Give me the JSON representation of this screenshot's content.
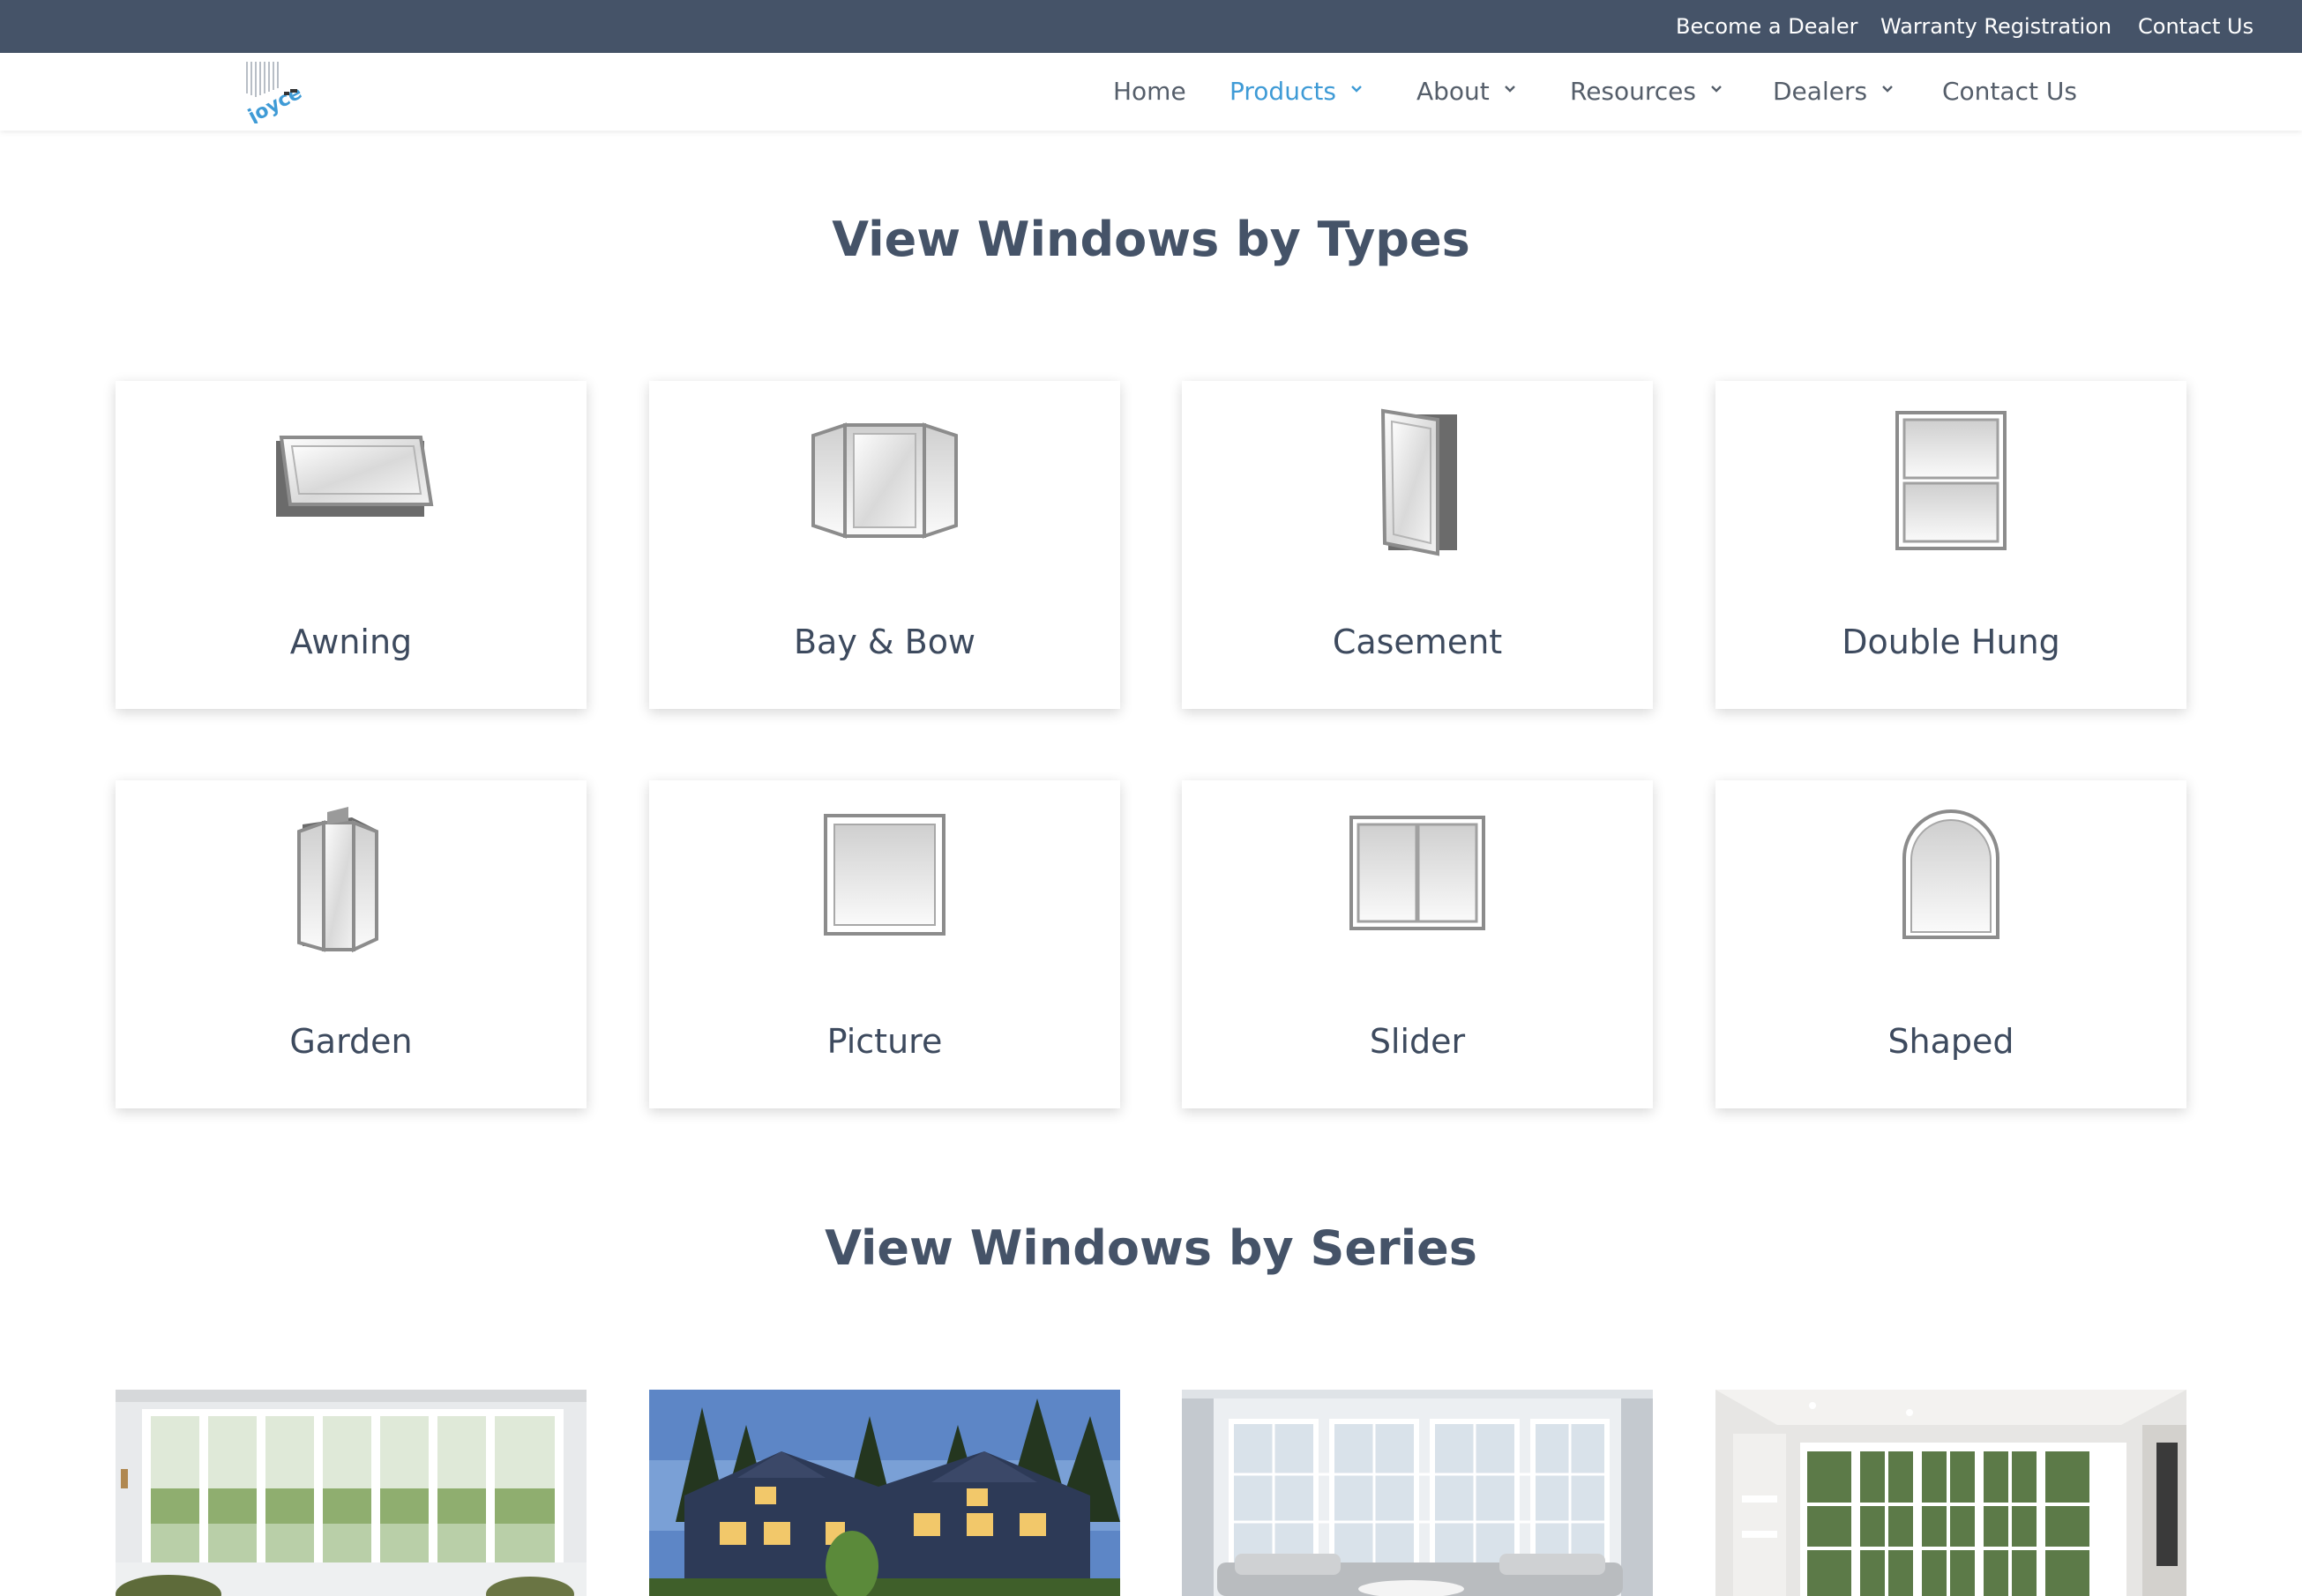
{
  "topbar": {
    "links": [
      "Become a Dealer",
      "Warranty Registration",
      "Contact Us"
    ]
  },
  "nav": {
    "logo_text": "joyce",
    "items": [
      "Home",
      "Products",
      "About",
      "Resources",
      "Dealers",
      "Contact Us"
    ],
    "active": "Products",
    "active_color": "#3f9bd6"
  },
  "types": {
    "title": "View Windows by Types",
    "cards": [
      "Awning",
      "Bay & Bow",
      "Casement",
      "Double Hung",
      "Garden",
      "Picture",
      "Slider",
      "Shaped"
    ]
  },
  "series": {
    "title": "View Windows by Series"
  },
  "colors": {
    "topbar": "#455368",
    "heading": "#455368",
    "accent": "#3f9bd6"
  }
}
